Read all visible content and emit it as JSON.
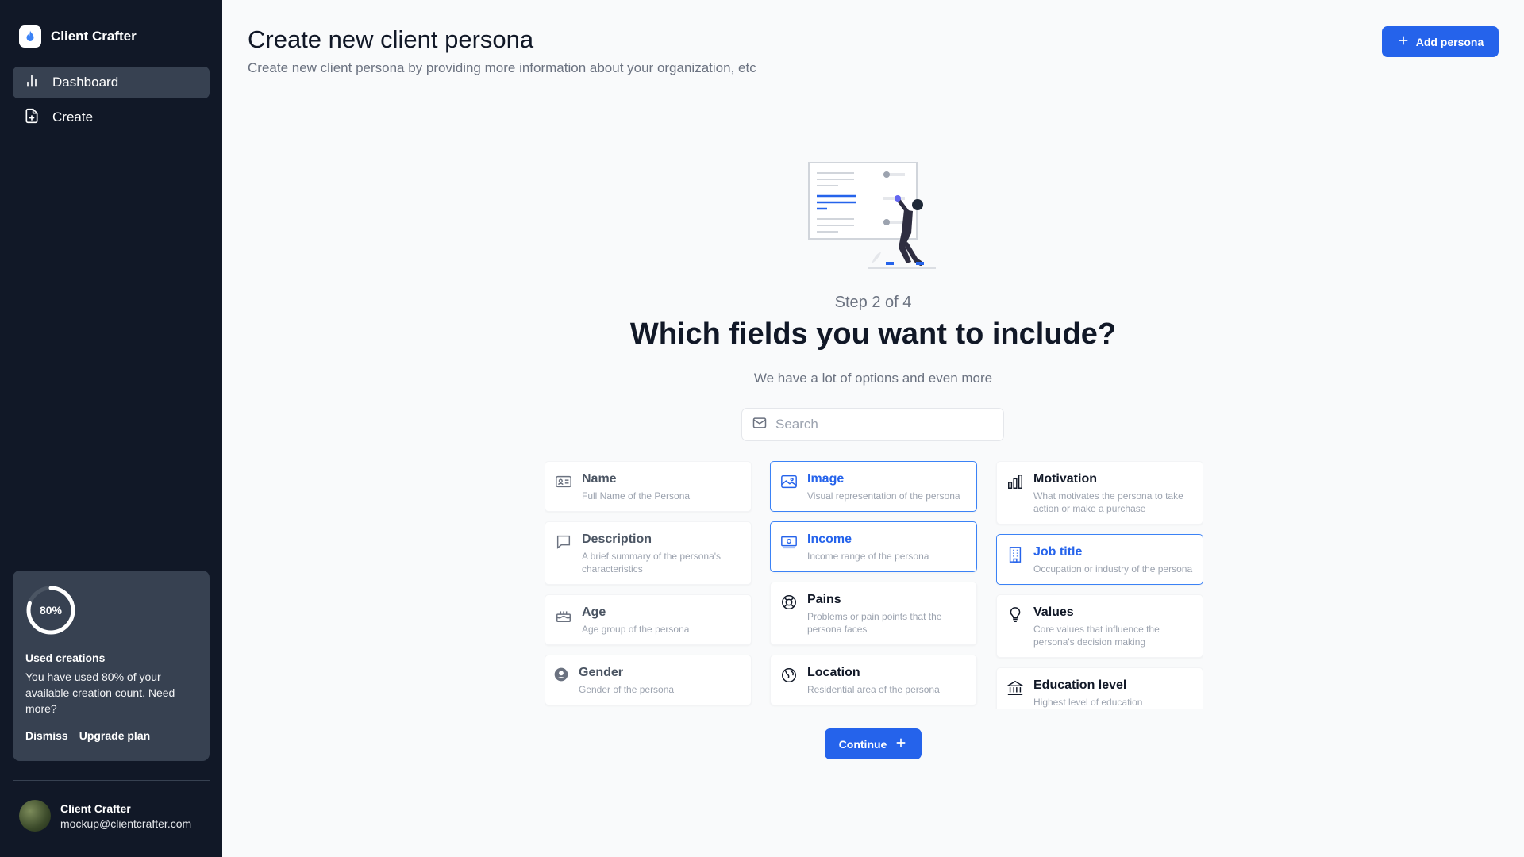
{
  "sidebar": {
    "brand": "Client Crafter",
    "nav": [
      {
        "label": "Dashboard",
        "icon": "bar-chart-icon",
        "active": true
      },
      {
        "label": "Create",
        "icon": "file-plus-icon",
        "active": false
      }
    ],
    "usage": {
      "percent_label": "80%",
      "percent": 80,
      "title": "Used creations",
      "description": "You have used 80% of your available creation count. Need more?",
      "dismiss": "Dismiss",
      "upgrade": "Upgrade plan"
    },
    "user": {
      "name": "Client Crafter",
      "email": "mockup@clientcrafter.com"
    }
  },
  "header": {
    "title": "Create new client persona",
    "subtitle": "Create new client persona by providing more information about your organization, etc",
    "add_button": "Add persona"
  },
  "wizard": {
    "step": "Step 2 of 4",
    "question": "Which fields you want to include?",
    "hint": "We have a lot of options and even more",
    "search_placeholder": "Search",
    "continue": "Continue"
  },
  "fields": {
    "col1": [
      {
        "title": "Name",
        "desc": "Full Name of the Persona",
        "icon": "id-card-icon"
      },
      {
        "title": "Description",
        "desc": "A brief summary of the persona's characteristics",
        "icon": "chat-bubble-icon"
      },
      {
        "title": "Age",
        "desc": "Age group of the persona",
        "icon": "cake-icon"
      },
      {
        "title": "Gender",
        "desc": "Gender of the persona",
        "icon": "user-circle-icon"
      }
    ],
    "col2": [
      {
        "title": "Image",
        "desc": "Visual representation of the persona",
        "icon": "image-icon",
        "selected": true
      },
      {
        "title": "Income",
        "desc": "Income range of the persona",
        "icon": "banknote-icon",
        "selected": true
      },
      {
        "title": "Pains",
        "desc": "Problems or pain points that the persona faces",
        "icon": "lifebuoy-icon",
        "selected": false
      },
      {
        "title": "Location",
        "desc": "Residential area of the persona",
        "icon": "globe-icon",
        "selected": false
      }
    ],
    "col3": [
      {
        "title": "Motivation",
        "desc": "What motivates the persona to take action or make a purchase",
        "icon": "bar-chart-icon",
        "selected": false
      },
      {
        "title": "Job title",
        "desc": "Occupation or industry of the persona",
        "icon": "building-icon",
        "selected": true
      },
      {
        "title": "Values",
        "desc": "Core values that influence the persona's decision making",
        "icon": "lightbulb-icon",
        "selected": false
      },
      {
        "title": "Education level",
        "desc": "Highest level of education",
        "icon": "bank-icon",
        "selected": false
      }
    ]
  },
  "colors": {
    "accent": "#2563eb",
    "sidebar": "#111827",
    "card": "#374151"
  }
}
